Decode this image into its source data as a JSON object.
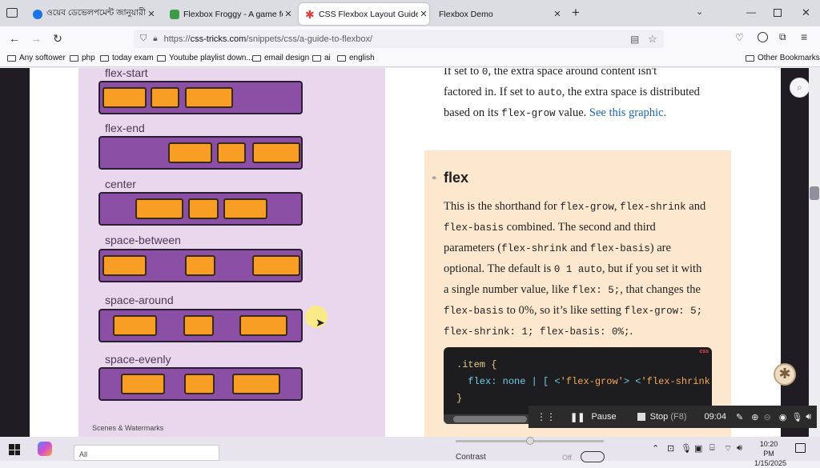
{
  "tabs": [
    {
      "title": "ওয়েব ডেভেলপমেন্ট জানুয়ারী ২০",
      "favicon_color": "#1a73e8"
    },
    {
      "title": "Flexbox Froggy - A game for le",
      "favicon_color": "#3f9b4a"
    },
    {
      "title": "CSS Flexbox Layout Guide | CSS",
      "favicon_color": "#e23a3a"
    },
    {
      "title": "Flexbox Demo",
      "favicon_color": ""
    }
  ],
  "new_tab_symbol": "+",
  "url": {
    "prefix": "https://",
    "domain": "css-tricks.com",
    "path": "/snippets/css/a-guide-to-flexbox/"
  },
  "bookmarks": [
    "Any softower",
    "php",
    "today exam",
    "Youtube playlist down...",
    "email design",
    "ai",
    "english"
  ],
  "other_bookmarks": "Other Bookmarks",
  "flex_examples": [
    {
      "label": "flex-start"
    },
    {
      "label": "flex-end"
    },
    {
      "label": "center"
    },
    {
      "label": "space-between"
    },
    {
      "label": "space-around"
    },
    {
      "label": "space-evenly"
    }
  ],
  "prose_top": {
    "line1": "If set to ",
    "code1": "0",
    "line1b": ", the extra space around content isn't",
    "line2a": "factored in. If set to ",
    "code2": "auto",
    "line2b": ", the extra space is distributed",
    "line3a": "based on its ",
    "code3": "flex-grow",
    "line3b": " value. ",
    "link": "See this graphic."
  },
  "flex_section": {
    "heading": "flex",
    "p1": "This is the shorthand for ",
    "c1": "flex-grow",
    "p2": ", ",
    "c2": "flex-shrink",
    "p3": " and",
    "c3": "flex-basis",
    "p4": " combined. The second and third",
    "p5": "parameters (",
    "c5": "flex-shrink",
    "p6": " and ",
    "c6": "flex-basis",
    "p7": ") are",
    "p8": "optional. The default is ",
    "c8": "0 1 auto",
    "p9": ", but if you set it with",
    "p10": "a single number value, like ",
    "c10": "flex: 5;",
    "p11": ", that changes the",
    "c12": "flex-basis",
    "p12": " to 0%, so it’s like setting ",
    "c12b": "flex-grow: 5;",
    "c13": "flex-shrink: 1; flex-basis: 0%;",
    "p13": "."
  },
  "code": {
    "tag": "css",
    "line1": ".item {",
    "line2_prop": "flex:",
    "line2_val": " none | [ <",
    "line2_s1": "'flex-grow'",
    "line2_mid": "> <",
    "line2_s2": "'flex-shrink'",
    "line2_end": ">?",
    "line3": "}"
  },
  "recorder": {
    "pause": "Pause",
    "stop": "Stop",
    "stop_key": "(F8)",
    "time": "09:04"
  },
  "below": {
    "scenes": "Scenes & Watermarks",
    "all": "All",
    "contrast": "Contrast",
    "off": "Off"
  },
  "taskbar": {
    "time": "10:20 PM",
    "date": "1/15/2025"
  }
}
